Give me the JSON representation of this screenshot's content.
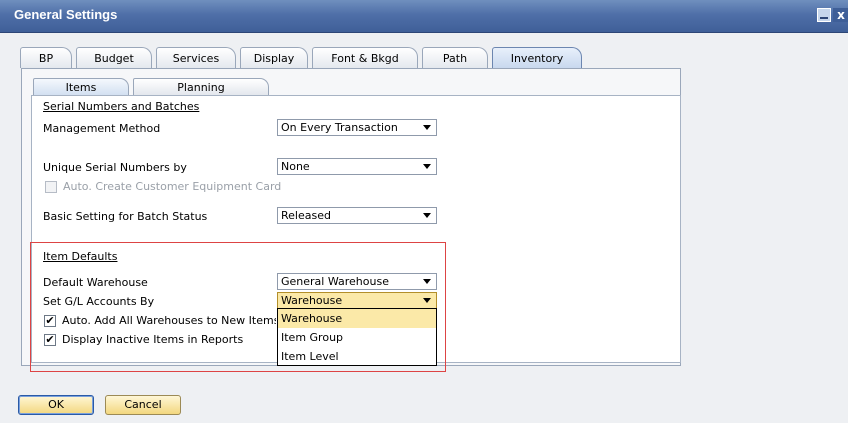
{
  "window": {
    "title": "General Settings",
    "close_glyph": "x"
  },
  "tabs": [
    {
      "label": "BP"
    },
    {
      "label": "Budget"
    },
    {
      "label": "Services"
    },
    {
      "label": "Display"
    },
    {
      "label": "Font & Bkgd"
    },
    {
      "label": "Path"
    },
    {
      "label": "Inventory",
      "active": true
    }
  ],
  "subtabs": [
    {
      "label": "Items",
      "active": true
    },
    {
      "label": "Planning"
    }
  ],
  "serial": {
    "heading": "Serial Numbers and Batches",
    "management_label": "Management Method",
    "management_value": "On Every Transaction",
    "unique_label": "Unique Serial Numbers by",
    "unique_value": "None",
    "auto_equipment_label": "Auto. Create Customer Equipment Card",
    "auto_equipment_checked": false,
    "batch_status_label": "Basic Setting for Batch Status",
    "batch_status_value": "Released"
  },
  "item_defaults": {
    "heading": "Item Defaults",
    "warehouse_label": "Default Warehouse",
    "warehouse_value": "General Warehouse",
    "gl_label": "Set G/L Accounts By",
    "gl_value": "Warehouse",
    "auto_add_label": "Auto. Add All Warehouses to New Items",
    "auto_add_checked": true,
    "inactive_label": "Display Inactive Items in Reports",
    "inactive_checked": true
  },
  "gl_dropdown": {
    "options": [
      "Warehouse",
      "Item Group",
      "Item Level"
    ],
    "selected": "Warehouse"
  },
  "buttons": {
    "ok": "OK",
    "cancel": "Cancel"
  },
  "colors": {
    "title_bar": "#4f6fa8",
    "highlight": "#fbe9a8",
    "group_border": "#dd4444"
  }
}
